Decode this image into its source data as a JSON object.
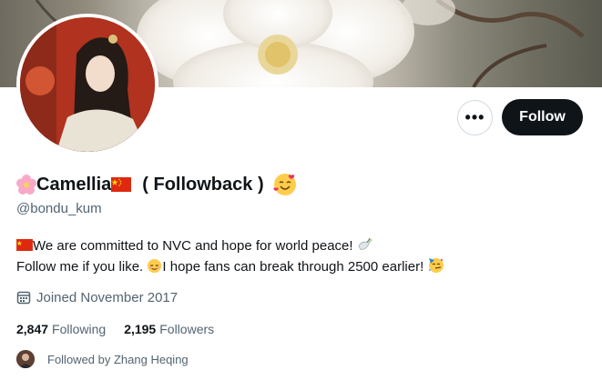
{
  "profile": {
    "display_name": "Camellia",
    "name_suffix": "( Followback )",
    "handle": "@bondu_kum",
    "bio_line1": "We are committed to NVC and hope for world peace!",
    "bio_line2a": "Follow me if you like.",
    "bio_line2b": "I hope fans can break through 2500 earlier!",
    "joined": "Joined November 2017"
  },
  "actions": {
    "more_label": "•••",
    "follow_label": "Follow"
  },
  "stats": {
    "following_count": "2,847",
    "following_label": "Following",
    "followers_count": "2,195",
    "followers_label": "Followers"
  },
  "followed_by": {
    "text": "Followed by Zhang Heqing"
  },
  "icons": {
    "name_prefix": "cherry-blossom-icon",
    "flag": "china-flag-icon",
    "name_suffix_emoji": "smiling-face-with-hearts-icon",
    "bio_line1_end": "dove-icon",
    "bio_line2_mid": "relieved-face-icon",
    "bio_line2_end": "partying-face-icon",
    "joined": "calendar-icon"
  },
  "colors": {
    "follow_button_bg": "#0f1419",
    "secondary_text": "#536471",
    "flag_red": "#de2910",
    "flag_star": "#ffde00"
  }
}
